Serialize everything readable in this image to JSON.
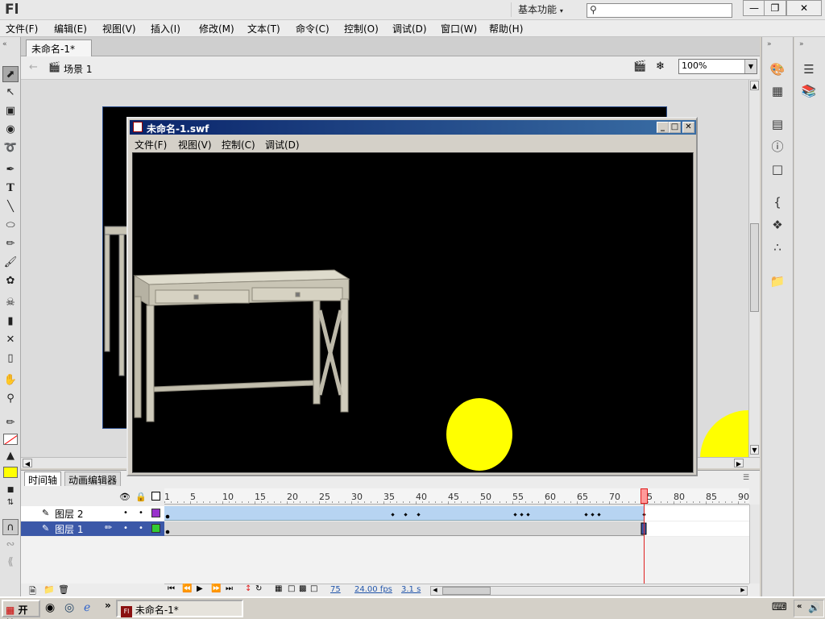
{
  "app": {
    "logo": "Fl",
    "workspace": "基本功能",
    "search_placeholder": ""
  },
  "menu": [
    "文件(F)",
    "编辑(E)",
    "视图(V)",
    "插入(I)",
    "修改(M)",
    "文本(T)",
    "命令(C)",
    "控制(O)",
    "调试(D)",
    "窗口(W)",
    "帮助(H)"
  ],
  "document_tab": "未命名-1*",
  "scene": {
    "label": "场景 1",
    "zoom": "100%"
  },
  "swf_window": {
    "title": "未命名-1.swf",
    "menu": [
      "文件(F)",
      "视图(V)",
      "控制(C)",
      "调试(D)"
    ]
  },
  "timeline": {
    "tabs": [
      "时间轴",
      "动画编辑器"
    ],
    "frame_numbers": [
      "1",
      "5",
      "10",
      "15",
      "20",
      "25",
      "30",
      "35",
      "40",
      "45",
      "50",
      "55",
      "60",
      "65",
      "70",
      "75",
      "80",
      "85",
      "90"
    ],
    "layers": [
      {
        "name": "图层 2",
        "color": "#9933cc"
      },
      {
        "name": "图层 1",
        "color": "#33cc33"
      }
    ],
    "playhead_frame": 75,
    "status": {
      "current_frame": "75",
      "fps": "24.00 fps",
      "time": "3.1 s"
    }
  },
  "taskbar": {
    "start": "开始",
    "task": "未命名-1*"
  },
  "colors": {
    "ball": "#ffff00",
    "stage": "#000000",
    "playhead": "#e02020",
    "fill": "#ffff00",
    "stroke": "#ff0000"
  }
}
